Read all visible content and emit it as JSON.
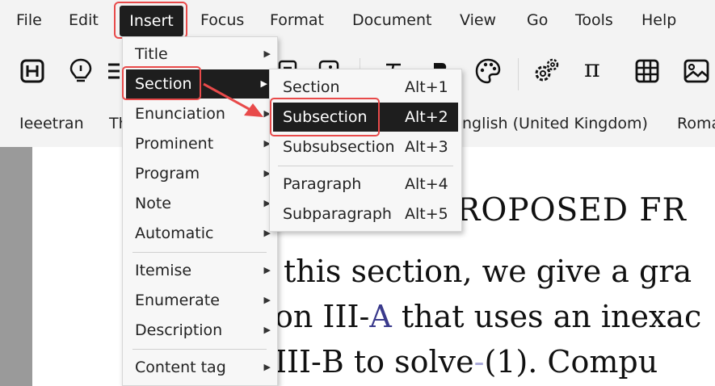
{
  "menubar": {
    "items": [
      "File",
      "Edit",
      "Insert",
      "Focus",
      "Format",
      "Document",
      "View",
      "Go",
      "Tools",
      "Help"
    ]
  },
  "toolbar": {
    "icons": [
      "heading-icon",
      "lightbulb-icon",
      "list-icon",
      "comment-icon",
      "image-frame-icon",
      "text-style-icon",
      "bold-icon",
      "palette-icon",
      "gears-icon",
      "pi-icon",
      "table-icon",
      "image-icon"
    ],
    "pi_glyph": "π"
  },
  "tagbar": {
    "tags": [
      "Ieeetran",
      "Th",
      "nglish (United Kingdom)",
      "Roma"
    ]
  },
  "insert_menu": {
    "items": [
      "Title",
      "Section",
      "Enunciation",
      "Prominent",
      "Program",
      "Note",
      "Automatic",
      "Itemise",
      "Enumerate",
      "Description",
      "Content tag"
    ]
  },
  "section_menu": {
    "items": [
      {
        "label": "Section",
        "shortcut": "Alt+1"
      },
      {
        "label": "Subsection",
        "shortcut": "Alt+2"
      },
      {
        "label": "Subsubsection",
        "shortcut": "Alt+3"
      },
      {
        "label": "Paragraph",
        "shortcut": "Alt+4"
      },
      {
        "label": "Subparagraph",
        "shortcut": "Alt+5"
      }
    ]
  },
  "document": {
    "heading": "ROPOSED FR",
    "line1": "this section, we give a gra",
    "line2_a": "on III-",
    "line2_link": "A",
    "line2_b": " that uses an inexac",
    "line3_a": "III-B to solve",
    "line3_hyphen": "-",
    "line3_b": "(1).  Compu"
  },
  "colors": {
    "highlight": "#e84a4a",
    "selected_bg": "#1e1e1e",
    "link": "#3a3a8c"
  }
}
